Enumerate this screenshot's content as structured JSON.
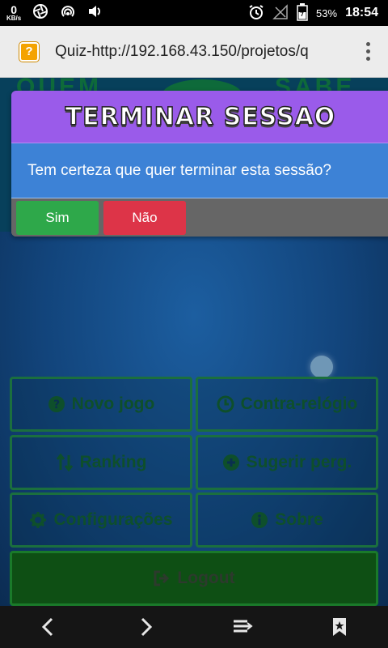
{
  "status_bar": {
    "net_speed_value": "0",
    "net_speed_unit": "KB/s",
    "battery_percent": "53%",
    "time": "18:54",
    "icons": [
      "aperture-icon",
      "wifi-hotspot-icon",
      "volume-icon",
      "alarm-icon",
      "signal-icon",
      "battery-icon"
    ]
  },
  "browser": {
    "favicon": "?",
    "title": "Quiz-http://192.168.43.150/projetos/q"
  },
  "page": {
    "menu": {
      "new_game": "Novo jogo",
      "timed": "Contra-relógio",
      "ranking": "Ranking",
      "suggest": "Sugerir perg.",
      "settings": "Configurações",
      "about": "Sobre",
      "logout": "Logout"
    }
  },
  "dialog": {
    "title": "TERMINAR SESSAO",
    "message": "Tem certeza que quer terminar esta sessão?",
    "yes_label": "Sim",
    "no_label": "Não",
    "colors": {
      "header": "#9a5bea",
      "body": "#3d82d6",
      "yes": "#2ea84a",
      "no": "#dd3448"
    }
  },
  "nav_bar": {
    "icons": [
      "back-icon",
      "forward-icon",
      "tabs-icon",
      "bookmark-icon"
    ]
  }
}
